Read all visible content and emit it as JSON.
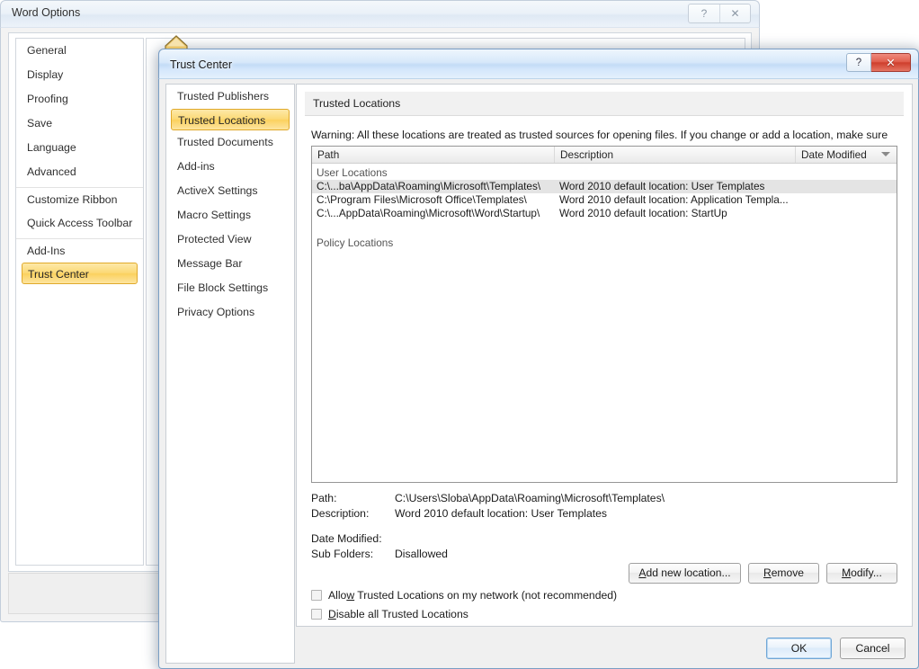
{
  "word_options": {
    "title": "Word Options",
    "caption_buttons": [
      {
        "name": "help",
        "glyph": "?"
      },
      {
        "name": "close",
        "glyph": "✕"
      }
    ],
    "nav_items": [
      {
        "label": "General",
        "selected": false,
        "separator_before": false
      },
      {
        "label": "Display",
        "selected": false,
        "separator_before": false
      },
      {
        "label": "Proofing",
        "selected": false,
        "separator_before": false
      },
      {
        "label": "Save",
        "selected": false,
        "separator_before": false
      },
      {
        "label": "Language",
        "selected": false,
        "separator_before": false
      },
      {
        "label": "Advanced",
        "selected": false,
        "separator_before": false
      },
      {
        "label": "Customize Ribbon",
        "selected": false,
        "separator_before": true
      },
      {
        "label": "Quick Access Toolbar",
        "selected": false,
        "separator_before": false
      },
      {
        "label": "Add-Ins",
        "selected": false,
        "separator_before": true
      },
      {
        "label": "Trust Center",
        "selected": true,
        "separator_before": false
      }
    ]
  },
  "trust_center": {
    "title": "Trust Center",
    "caption_help": "?",
    "caption_close": "✕",
    "nav_items": [
      {
        "label": "Trusted Publishers",
        "selected": false
      },
      {
        "label": "Trusted Locations",
        "selected": true
      },
      {
        "label": "Trusted Documents",
        "selected": false
      },
      {
        "label": "Add-ins",
        "selected": false
      },
      {
        "label": "ActiveX Settings",
        "selected": false
      },
      {
        "label": "Macro Settings",
        "selected": false
      },
      {
        "label": "Protected View",
        "selected": false
      },
      {
        "label": "Message Bar",
        "selected": false
      },
      {
        "label": "File Block Settings",
        "selected": false
      },
      {
        "label": "Privacy Options",
        "selected": false
      }
    ],
    "pane_heading": "Trusted Locations",
    "warning": "Warning: All these locations are treated as trusted sources for opening files.  If you change or add a location, make sure that the new location is secure.",
    "list": {
      "columns": [
        {
          "key": "path",
          "label": "Path"
        },
        {
          "key": "description",
          "label": "Description"
        },
        {
          "key": "date_modified",
          "label": "Date Modified",
          "sorted": true
        }
      ],
      "groups": [
        {
          "label": "User Locations",
          "rows": [
            {
              "path": "C:\\...ba\\AppData\\Roaming\\Microsoft\\Templates\\",
              "description": "Word 2010 default location: User Templates",
              "date_modified": "",
              "selected": true
            },
            {
              "path": "C:\\Program Files\\Microsoft Office\\Templates\\",
              "description": "Word 2010 default location: Application Templa...",
              "date_modified": "",
              "selected": false
            },
            {
              "path": "C:\\...AppData\\Roaming\\Microsoft\\Word\\Startup\\",
              "description": "Word 2010 default location: StartUp",
              "date_modified": "",
              "selected": false
            }
          ]
        },
        {
          "label": "Policy Locations",
          "rows": []
        }
      ]
    },
    "details": {
      "path_label": "Path:",
      "path_value": "C:\\Users\\Sloba\\AppData\\Roaming\\Microsoft\\Templates\\",
      "description_label": "Description:",
      "description_value": "Word 2010 default location: User Templates",
      "date_modified_label": "Date Modified:",
      "date_modified_value": "",
      "sub_folders_label": "Sub Folders:",
      "sub_folders_value": "Disallowed"
    },
    "actions": {
      "add_prefix": "A",
      "add_rest": "dd new location...",
      "remove_prefix": "R",
      "remove_rest": "emove",
      "modify_prefix": "M",
      "modify_rest": "odify..."
    },
    "checkboxes": [
      {
        "pre": "Allo",
        "accel": "w",
        "post": " Trusted Locations on my network (not recommended)",
        "checked": false
      },
      {
        "pre": "",
        "accel": "D",
        "post": "isable all Trusted Locations",
        "checked": false
      }
    ],
    "footer": {
      "ok_label": "OK",
      "cancel_label": "Cancel"
    }
  },
  "colors": {
    "selection_gold": "#fbd15e",
    "gold_border": "#e0a92b",
    "close_red": "#cf3f2d",
    "row_selected": "#e4e4e4",
    "glass_blue": "#c3dcf6"
  }
}
